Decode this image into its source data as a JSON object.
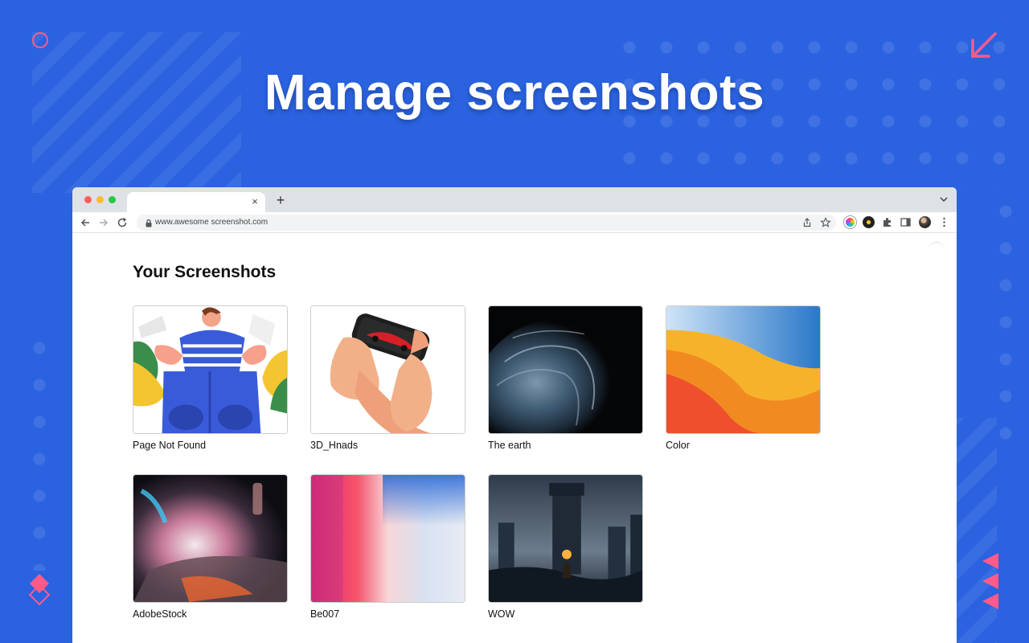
{
  "headline": "Manage screenshots",
  "browser": {
    "url": "www.awesome screenshot.com",
    "tab_close": "×",
    "tab_new": "+"
  },
  "page": {
    "title": "Your Screenshots",
    "screenshots": [
      {
        "name": "Page Not Found",
        "icon": "illustration-thumbnail"
      },
      {
        "name": "3D_Hnads",
        "icon": "hands-phone-thumbnail"
      },
      {
        "name": "The earth",
        "icon": "dark-wave-thumbnail"
      },
      {
        "name": "Color",
        "icon": "color-waves-thumbnail"
      },
      {
        "name": "AdobeStock",
        "icon": "splash-thumbnail"
      },
      {
        "name": "Be007",
        "icon": "gradient-thumbnail"
      },
      {
        "name": "WOW",
        "icon": "fantasy-tower-thumbnail"
      }
    ]
  },
  "colors": {
    "background": "#2a62e0",
    "accent_pink": "#ff5a8a"
  }
}
